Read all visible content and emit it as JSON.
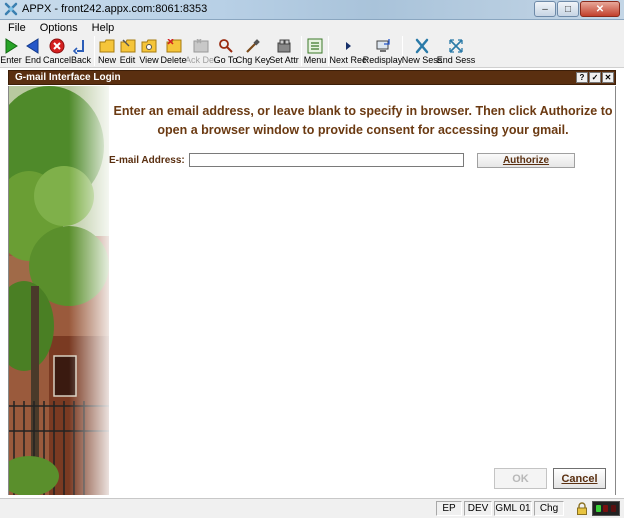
{
  "window": {
    "title": "APPX - front242.appx.com:8061:8353",
    "min_glyph": "–",
    "max_glyph": "□",
    "close_glyph": "✕"
  },
  "menu": [
    "File",
    "Options",
    "Help"
  ],
  "toolbar": [
    {
      "label": "Enter",
      "icon": "enter-icon",
      "enabled": true
    },
    {
      "label": "End",
      "icon": "end-icon",
      "enabled": true
    },
    {
      "label": "Cancel",
      "icon": "cancel-icon",
      "enabled": true
    },
    {
      "label": "Back",
      "icon": "back-icon",
      "enabled": true
    },
    {
      "label": "New",
      "icon": "new-folder-icon",
      "enabled": true
    },
    {
      "label": "Edit",
      "icon": "edit-folder-icon",
      "enabled": true
    },
    {
      "label": "View",
      "icon": "view-folder-icon",
      "enabled": true
    },
    {
      "label": "Delete",
      "icon": "delete-folder-icon",
      "enabled": true
    },
    {
      "label": "Ack Del",
      "icon": "ack-delete-icon",
      "enabled": false
    },
    {
      "label": "Go To",
      "icon": "go-to-icon",
      "enabled": true
    },
    {
      "label": "Chg Key",
      "icon": "change-key-icon",
      "enabled": true
    },
    {
      "label": "Set Attr",
      "icon": "set-attributes-icon",
      "enabled": true
    },
    {
      "label": "Menu",
      "icon": "menu-icon",
      "enabled": true
    },
    {
      "label": "Next Rec",
      "icon": "next-record-icon",
      "enabled": true
    },
    {
      "label": "Redisplay",
      "icon": "redisplay-icon",
      "enabled": true
    },
    {
      "label": "New Sess",
      "icon": "new-session-icon",
      "enabled": true
    },
    {
      "label": "End Sess",
      "icon": "end-session-icon",
      "enabled": true
    }
  ],
  "form": {
    "title": "G-mail Interface Login",
    "header_buttons": [
      "?",
      "✓",
      "✕"
    ],
    "instructions": "Enter an email address, or leave blank to specify in browser. Then click Authorize to open a browser window to provide consent for accessing your gmail.",
    "email_label": "E-mail Address:",
    "email_value": "",
    "authorize_label": "Authorize",
    "ok_label": "OK",
    "cancel_label": "Cancel"
  },
  "status": {
    "cells": [
      "EP",
      "DEV",
      "GML 01",
      "Chg"
    ]
  },
  "colors": {
    "form_header": "#5a2f10",
    "accent_text": "#6b3a12"
  }
}
